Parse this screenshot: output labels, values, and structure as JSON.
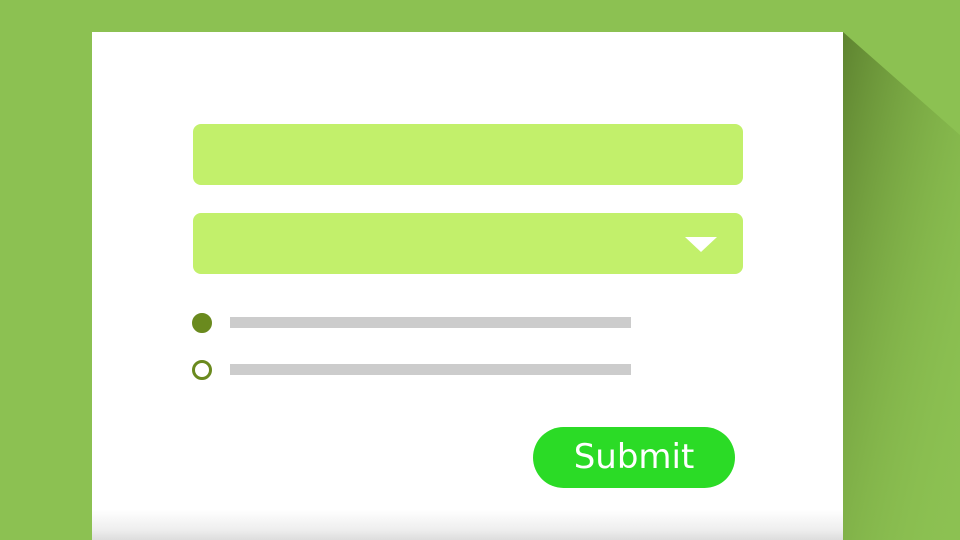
{
  "form": {
    "text_field": {
      "value": "",
      "placeholder": ""
    },
    "select_field": {
      "selected": "",
      "arrow_icon": "caret-down-icon"
    },
    "radio_options": [
      {
        "checked": true,
        "label": ""
      },
      {
        "checked": false,
        "label": ""
      }
    ],
    "submit_label": "Submit"
  },
  "colors": {
    "background": "#8cc152",
    "card": "#ffffff",
    "field": "#c2f06b",
    "radio": "#6a8a1e",
    "placeholder_line": "#cccccc",
    "submit": "#2bdb26"
  }
}
